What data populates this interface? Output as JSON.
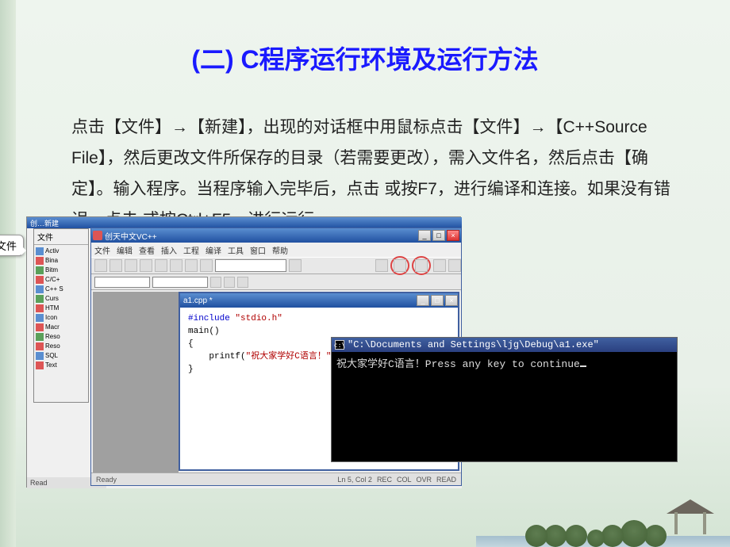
{
  "title": "(二) C程序运行环境及运行方法",
  "body_text": "点击【文件】→【新建】，出现的对话框中用鼠标点击【文件】→【C++Source File】，然后更改文件所保存的目录（若需要更改），需入文件名，然后点击【确定】。输入程序。当程序输入完毕后，点击 或按F7，进行编译和连接。如果没有错误，点击  或按Ctrl+F5，进行运行。",
  "callout": {
    "file_label": "文件"
  },
  "window1": {
    "title": "创…新建",
    "tab_label": "文件",
    "file_types": [
      "Activ",
      "Bina",
      "Bitm",
      "C/C+",
      "C++ S",
      "Curs",
      "HTM",
      "Icon",
      "Macr",
      "Reso",
      "Reso",
      "SQL",
      "Text"
    ],
    "status": "Read"
  },
  "window2": {
    "title": "创天中文VC++",
    "menus": [
      "文件",
      "编辑",
      "查看",
      "插入",
      "工程",
      "编译",
      "工具",
      "窗口",
      "帮助"
    ],
    "editor": {
      "tab_title": "a1.cpp *",
      "code_lines": [
        "#include \"stdio.h\"",
        "main()",
        "{",
        "    printf(\"祝大家学好C语言！\");",
        "}"
      ]
    },
    "statusbar": {
      "left": "Ready",
      "pos": "Ln 5, Col 2",
      "indicators": [
        "REC",
        "COL",
        "OVR",
        "READ"
      ]
    }
  },
  "console": {
    "title": "\"C:\\Documents and Settings\\ljg\\Debug\\a1.exe\"",
    "output": "祝大家学好C语言！Press any key to continue"
  }
}
